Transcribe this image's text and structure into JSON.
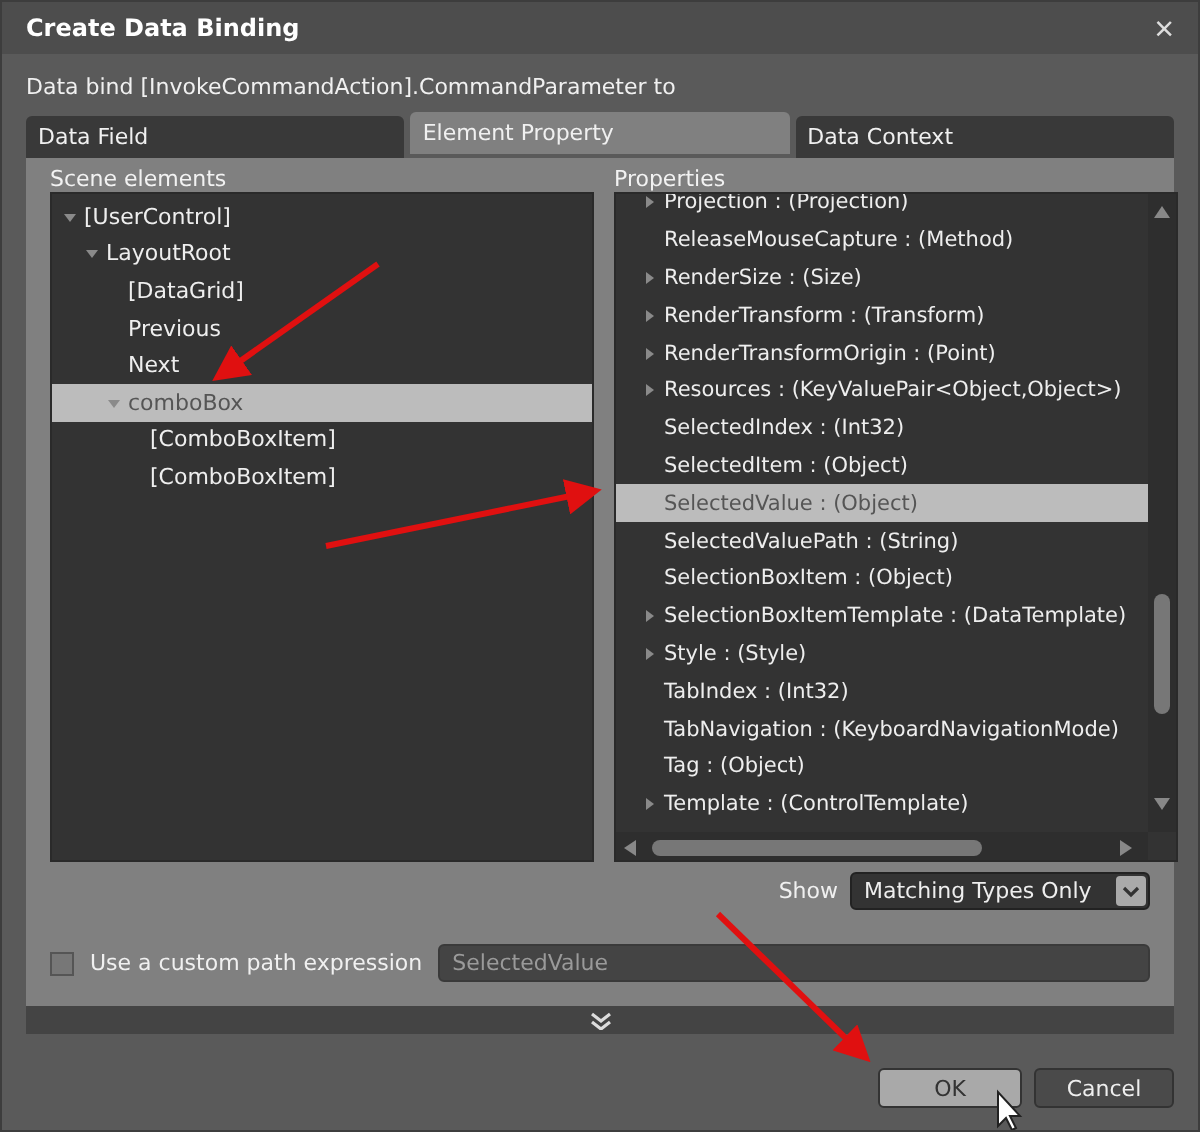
{
  "window": {
    "title": "Create Data Binding",
    "close": "×"
  },
  "caption": "Data bind [InvokeCommandAction].CommandParameter to",
  "tabs": [
    {
      "label": "Data Field",
      "selected": false
    },
    {
      "label": "Element Property",
      "selected": true
    },
    {
      "label": "Data Context",
      "selected": false
    }
  ],
  "scene": {
    "heading": "Scene elements",
    "nodes": [
      {
        "label": "[UserControl]",
        "expanded": true,
        "selected": false,
        "children": [
          {
            "label": "LayoutRoot",
            "expanded": true,
            "selected": false,
            "children": [
              {
                "label": "[DataGrid]",
                "selected": false
              },
              {
                "label": "Previous",
                "selected": false
              },
              {
                "label": "Next",
                "selected": false
              },
              {
                "label": "comboBox",
                "expanded": true,
                "selected": true,
                "children": [
                  {
                    "label": "[ComboBoxItem]",
                    "selected": false
                  },
                  {
                    "label": "[ComboBoxItem]",
                    "selected": false
                  }
                ]
              }
            ]
          }
        ]
      }
    ]
  },
  "properties": {
    "heading": "Properties",
    "items": [
      {
        "label": "Projection : (Projection)",
        "expandable": true,
        "selected": false
      },
      {
        "label": "ReleaseMouseCapture : (Method)",
        "expandable": false,
        "selected": false
      },
      {
        "label": "RenderSize : (Size)",
        "expandable": true,
        "selected": false
      },
      {
        "label": "RenderTransform : (Transform)",
        "expandable": true,
        "selected": false
      },
      {
        "label": "RenderTransformOrigin : (Point)",
        "expandable": true,
        "selected": false
      },
      {
        "label": "Resources : (KeyValuePair<Object,Object>)",
        "expandable": true,
        "selected": false
      },
      {
        "label": "SelectedIndex : (Int32)",
        "expandable": false,
        "selected": false
      },
      {
        "label": "SelectedItem : (Object)",
        "expandable": false,
        "selected": false
      },
      {
        "label": "SelectedValue : (Object)",
        "expandable": false,
        "selected": true
      },
      {
        "label": "SelectedValuePath : (String)",
        "expandable": false,
        "selected": false
      },
      {
        "label": "SelectionBoxItem : (Object)",
        "expandable": false,
        "selected": false
      },
      {
        "label": "SelectionBoxItemTemplate : (DataTemplate)",
        "expandable": true,
        "selected": false
      },
      {
        "label": "Style : (Style)",
        "expandable": true,
        "selected": false
      },
      {
        "label": "TabIndex : (Int32)",
        "expandable": false,
        "selected": false
      },
      {
        "label": "TabNavigation : (KeyboardNavigationMode)",
        "expandable": false,
        "selected": false
      },
      {
        "label": "Tag : (Object)",
        "expandable": false,
        "selected": false
      },
      {
        "label": "Template : (ControlTemplate)",
        "expandable": true,
        "selected": false
      }
    ]
  },
  "show": {
    "label": "Show",
    "value": "Matching Types Only"
  },
  "custom_path": {
    "label": "Use a custom path expression",
    "checked": false,
    "placeholder": "SelectedValue"
  },
  "buttons": [
    {
      "label": "OK",
      "selected": true
    },
    {
      "label": "Cancel",
      "selected": false
    }
  ]
}
